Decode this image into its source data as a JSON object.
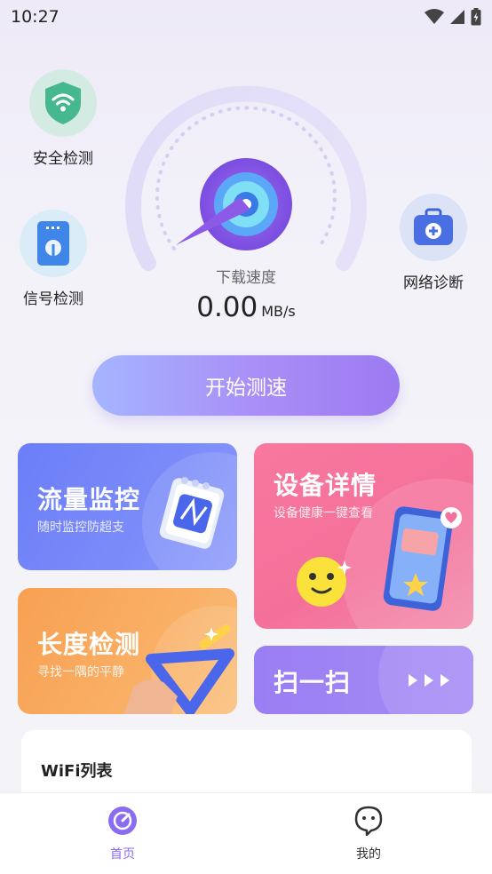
{
  "status_bar": {
    "time": "10:27"
  },
  "features": {
    "security": {
      "label": "安全检测"
    },
    "signal": {
      "label": "信号检测"
    },
    "diagnosis": {
      "label": "网络诊断"
    }
  },
  "speed": {
    "label": "下载速度",
    "value": "0.00",
    "unit": "MB/s"
  },
  "start_button": {
    "label": "开始测速"
  },
  "cards": {
    "traffic": {
      "title": "流量监控",
      "subtitle": "随时监控防超支"
    },
    "device": {
      "title": "设备详情",
      "subtitle": "设备健康一键查看"
    },
    "length": {
      "title": "长度检测",
      "subtitle": "寻找一隅的平静"
    },
    "scan": {
      "title": "扫一扫"
    }
  },
  "wifi_list": {
    "title": "WiFi列表"
  },
  "nav": {
    "home": {
      "label": "首页"
    },
    "mine": {
      "label": "我的"
    }
  },
  "colors": {
    "accent": "#8a6cf0",
    "traffic_card": "#6f7cf7",
    "device_card": "#f36f9c",
    "length_card": "#f9a155",
    "scan_card": "#9b80f2"
  }
}
